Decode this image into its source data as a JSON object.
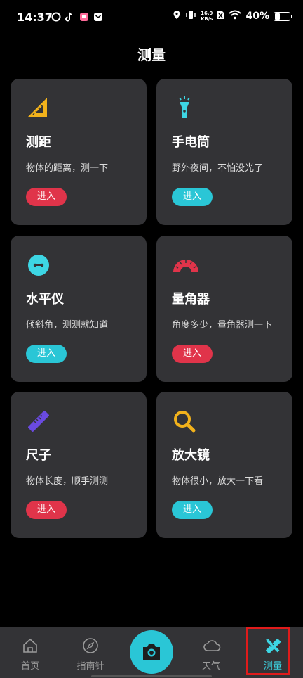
{
  "status_bar": {
    "time": "14:37",
    "net_speed_value": "16.9",
    "net_speed_unit": "KB/s",
    "battery_percent": "40%",
    "battery_level": 0.4
  },
  "page": {
    "title": "测量"
  },
  "cards": [
    {
      "title": "测距",
      "desc": "物体的距离，测一下",
      "button": "进入",
      "icon": "ruler-triangle-icon",
      "accent": "#f2b21b",
      "button_color": "#e0344a"
    },
    {
      "title": "手电筒",
      "desc": "野外夜间，不怕没光了",
      "button": "进入",
      "icon": "flashlight-icon",
      "accent": "#3dd6e4",
      "button_color": "#2ac6d6"
    },
    {
      "title": "水平仪",
      "desc": "倾斜角，测测就知道",
      "button": "进入",
      "icon": "level-icon",
      "accent": "#3dd6e4",
      "button_color": "#2ac6d6"
    },
    {
      "title": "量角器",
      "desc": "角度多少，量角器测一下",
      "button": "进入",
      "icon": "protractor-icon",
      "accent": "#e0344a",
      "button_color": "#e0344a"
    },
    {
      "title": "尺子",
      "desc": "物体长度，顺手测测",
      "button": "进入",
      "icon": "ruler-icon",
      "accent": "#6a4ae0",
      "button_color": "#e0344a"
    },
    {
      "title": "放大镜",
      "desc": "物体很小，放大一下看",
      "button": "进入",
      "icon": "magnifier-icon",
      "accent": "#f2b21b",
      "button_color": "#2ac6d6"
    }
  ],
  "bottom_nav": {
    "items": [
      {
        "label": "首页",
        "icon": "home-icon"
      },
      {
        "label": "指南针",
        "icon": "compass-icon"
      },
      {
        "label": "",
        "icon": "camera-icon"
      },
      {
        "label": "天气",
        "icon": "cloud-icon"
      },
      {
        "label": "测量",
        "icon": "ruler-pencil-icon",
        "active": true
      }
    ]
  }
}
